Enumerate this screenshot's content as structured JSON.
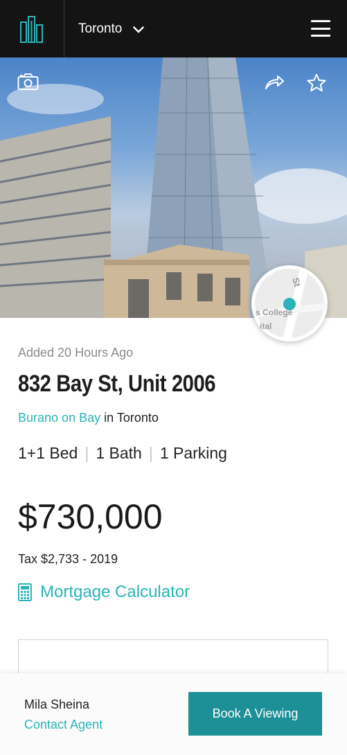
{
  "header": {
    "logo_icon": "buildings-logo-icon",
    "city": "Toronto",
    "menu_icon": "hamburger-menu-icon"
  },
  "hero": {
    "photo_icon": "camera-icon",
    "share_icon": "share-icon",
    "favorite_icon": "star-icon",
    "map_labels": [
      "St",
      "s College",
      "ital"
    ]
  },
  "listing": {
    "added": "Added 20 Hours Ago",
    "address": "832 Bay St, Unit 2006",
    "building": "Burano on Bay",
    "in_word": "in",
    "city": "Toronto",
    "beds": "1+1 Bed",
    "baths": "1 Bath",
    "parking": "1 Parking",
    "price": "$730,000",
    "tax": "Tax $2,733 - 2019",
    "mortgage_label": "Mortgage Calculator",
    "mortgage_icon": "calculator-icon"
  },
  "bottom_bar": {
    "agent_name": "Mila Sheina",
    "contact_label": "Contact Agent",
    "book_label": "Book A Viewing"
  },
  "colors": {
    "accent": "#2ab4b8",
    "button": "#1d8f97",
    "header_bg": "#141414"
  }
}
